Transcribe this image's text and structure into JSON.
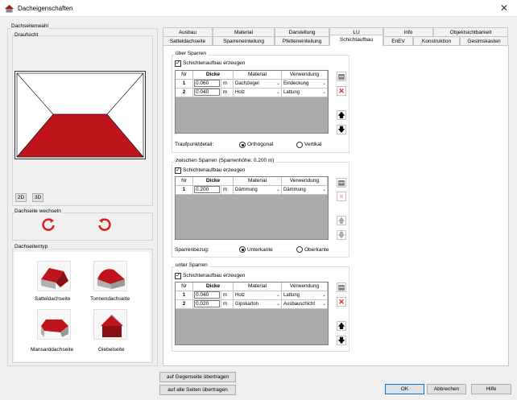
{
  "window": {
    "title": "Dacheigenschaften",
    "close": "✕"
  },
  "left": {
    "group_title": "Dachseitenwahl",
    "draufsicht": "Draufsicht",
    "btn_2d": "2D",
    "btn_3d": "3D",
    "wechseln": "Dachseite wechseln",
    "dachseitentyp": "Dachseitentyp",
    "types": [
      "Satteldachseite",
      "Tonnendachseite",
      "Mansarddachseite",
      "Giebelseite"
    ]
  },
  "tabs_row1": [
    "Ausbau",
    "Material",
    "Darstellung",
    "LU",
    "Info",
    "Objektsichtbarkeit"
  ],
  "tabs_row2": [
    "Satteldachseite",
    "Sparreneinteilung",
    "Pfetteneinteilung",
    "Schichtaufbau",
    "EnEV",
    "Konstruktion",
    "Gesimskasten"
  ],
  "active_tab": "Schichtaufbau",
  "ueber": {
    "title": "über Sparren",
    "checkbox": "Schichtenaufbau erzeugen",
    "headers": [
      "Nr",
      "Dicke",
      "Material",
      "Verwendung"
    ],
    "rows": [
      {
        "nr": "1",
        "dicke": "0.060",
        "unit": "m",
        "material": "Dachziegel",
        "verwendung": "Eindeckung"
      },
      {
        "nr": "2",
        "dicke": "0.040",
        "unit": "m",
        "material": "Holz",
        "verwendung": "Lattung"
      }
    ],
    "traufpunkt_label": "Traufpunktdetail:",
    "opt1": "Orthogonal",
    "opt2": "Vertikal"
  },
  "zwischen": {
    "title": "zwischen Sparren (Sparrenhöhe: 0.200 m)",
    "checkbox": "Schichtenaufbau erzeugen",
    "headers": [
      "Nr",
      "Dicke",
      "Material",
      "Verwendung"
    ],
    "rows": [
      {
        "nr": "1",
        "dicke": "0.200",
        "unit": "m",
        "material": "Dämmung",
        "verwendung": "Dämmung"
      }
    ],
    "bezug_label": "Sparrenbezug:",
    "opt1": "Unterkante",
    "opt2": "Oberkante"
  },
  "unter": {
    "title": "unter Sparren",
    "checkbox": "Schichtenaufbau erzeugen",
    "headers": [
      "Nr",
      "Dicke",
      "Material",
      "Verwendung"
    ],
    "rows": [
      {
        "nr": "1",
        "dicke": "0.040",
        "unit": "m",
        "material": "Holz",
        "verwendung": "Lattung"
      },
      {
        "nr": "2",
        "dicke": "0.020",
        "unit": "m",
        "material": "Gipskarton",
        "verwendung": "Ausbauschicht"
      }
    ]
  },
  "bottom": {
    "btn_gegenseite": "auf Gegenseite übertragen",
    "btn_alle": "auf alle Seiten übertragen",
    "ok": "OK",
    "abbrechen": "Abbrechen",
    "hilfe": "Hilfe"
  },
  "colors": {
    "roof": "#c0141c",
    "accent": "#0078d7"
  }
}
